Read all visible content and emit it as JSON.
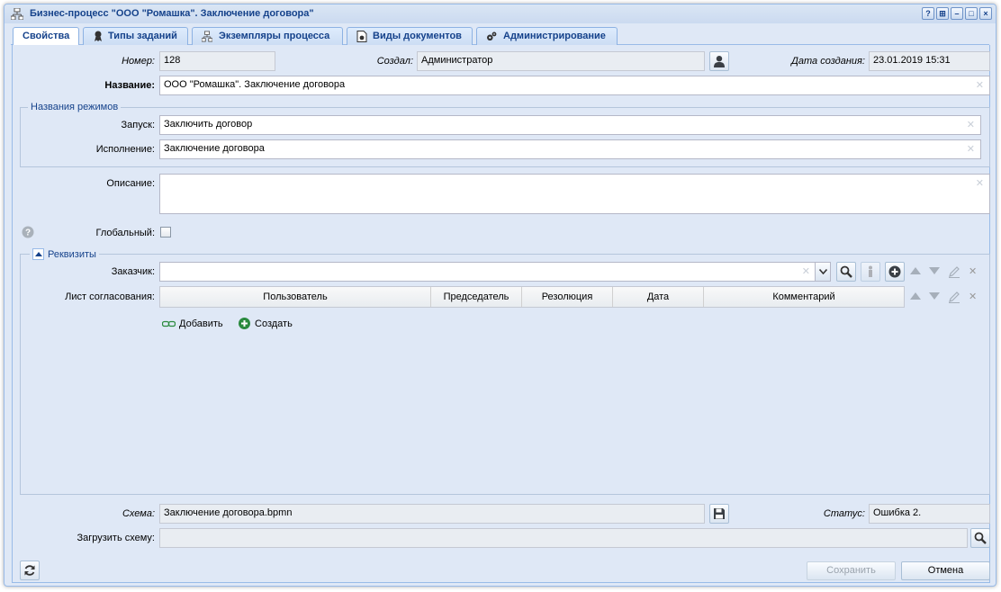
{
  "window": {
    "title": "Бизнес-процесс \"ООО \"Ромашка\". Заключение договора\"",
    "controls": [
      "?",
      "⊞",
      "–",
      "□",
      "×"
    ]
  },
  "tabs": [
    {
      "label": "Свойства",
      "icon": "",
      "active": true
    },
    {
      "label": "Типы заданий",
      "icon": "award-icon",
      "active": false
    },
    {
      "label": "Экземпляры процесса",
      "icon": "hierarchy-icon",
      "active": false
    },
    {
      "label": "Виды документов",
      "icon": "document-gear-icon",
      "active": false
    },
    {
      "label": "Администрирование",
      "icon": "gears-icon",
      "active": false
    }
  ],
  "form": {
    "number_label": "Номер:",
    "number_value": "128",
    "created_by_label": "Создал:",
    "created_by_value": "Администратор",
    "created_date_label": "Дата создания:",
    "created_date_value": "23.01.2019 15:31",
    "name_label": "Название:",
    "name_value": "ООО \"Ромашка\". Заключение договора",
    "modes_legend": "Названия режимов",
    "launch_label": "Запуск:",
    "launch_value": "Заключить договор",
    "execution_label": "Исполнение:",
    "execution_value": "Заключение договора",
    "description_label": "Описание:",
    "description_value": "",
    "global_label": "Глобальный:",
    "global_checked": false
  },
  "requisites": {
    "legend": "Реквизиты",
    "customer_label": "Заказчик:",
    "customer_value": "",
    "approval_label": "Лист согласования:",
    "columns": [
      "Пользователь",
      "Председатель",
      "Резолюция",
      "Дата",
      "Комментарий"
    ],
    "add_label": "Добавить",
    "create_label": "Создать"
  },
  "bottom": {
    "schema_label": "Схема:",
    "schema_value": "Заключение договора.bpmn",
    "status_label": "Статус:",
    "status_value": "Ошибка 2.",
    "upload_label": "Загрузить схему:",
    "upload_value": "",
    "save_label": "Сохранить",
    "cancel_label": "Отмена"
  },
  "colors": {
    "accent": "#15428b",
    "panel_bg": "#dfe8f6",
    "border": "#99bbe8",
    "create_green": "#2a8a3e"
  }
}
